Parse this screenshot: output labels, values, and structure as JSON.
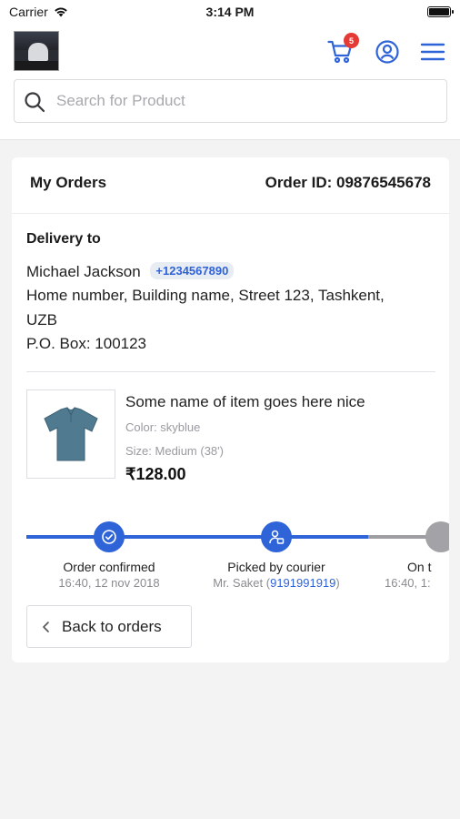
{
  "status_bar": {
    "carrier": "Carrier",
    "time": "3:14 PM"
  },
  "header": {
    "cart_count": "5",
    "search": {
      "placeholder": "Search for Product",
      "value": ""
    }
  },
  "order": {
    "title": "My Orders",
    "order_id": "Order ID: 09876545678",
    "delivery": {
      "label": "Delivery to",
      "name": "Michael Jackson",
      "phone": "+1234567890",
      "address_line1": "Home number, Building name, Street 123, Tashkent,",
      "address_line2": "UZB",
      "po_box": "P.O. Box: 100123"
    },
    "item": {
      "name": "Some name of item goes here nice",
      "color": "Color: skyblue",
      "size": "Size: Medium (38')",
      "price": "₹128.00"
    },
    "steps": [
      {
        "label": "Order confirmed",
        "sub": "16:40, 12 nov 2018",
        "status": "done"
      },
      {
        "label": "Picked by courier",
        "sub_prefix": "Mr. Saket (",
        "sub_link": "9191991919",
        "sub_suffix": ")",
        "status": "done"
      },
      {
        "label": "On t",
        "sub": "16:40, 1:",
        "status": "pending"
      }
    ],
    "back_label": "Back to orders"
  },
  "colors": {
    "accent": "#2f63d8",
    "badge": "#e53935",
    "pending": "#a3a3a7"
  }
}
